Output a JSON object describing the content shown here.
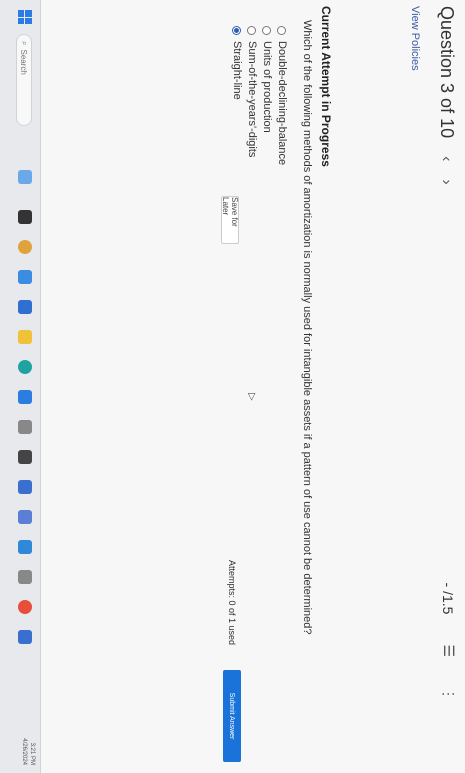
{
  "header": {
    "question_label": "Question 3 of 10",
    "prev_icon": "chevron-left-icon",
    "next_icon": "chevron-right-icon",
    "score": "- /1.5",
    "list_icon": "list-icon",
    "more_icon": "more-vertical-icon"
  },
  "links": {
    "view_policies": "View Policies"
  },
  "attempt": {
    "title": "Current Attempt in Progress",
    "question": "Which of the following methods of amortization is normally used for intangible assets if a pattern of use cannot be determined?",
    "options": [
      {
        "label": "Double-declining-balance",
        "selected": false
      },
      {
        "label": "Units of production",
        "selected": false
      },
      {
        "label": "Sum-of-the-years'-digits",
        "selected": false
      },
      {
        "label": "Straight-line",
        "selected": true
      }
    ],
    "save_label": "Save for Later",
    "attempts_text": "Attempts: 0 of 1 used",
    "submit_label": "Submit Answer"
  },
  "taskbar": {
    "search_placeholder": "Search",
    "time": "3:21 PM",
    "date": "4/26/2024",
    "accent": "#1a73d9"
  }
}
